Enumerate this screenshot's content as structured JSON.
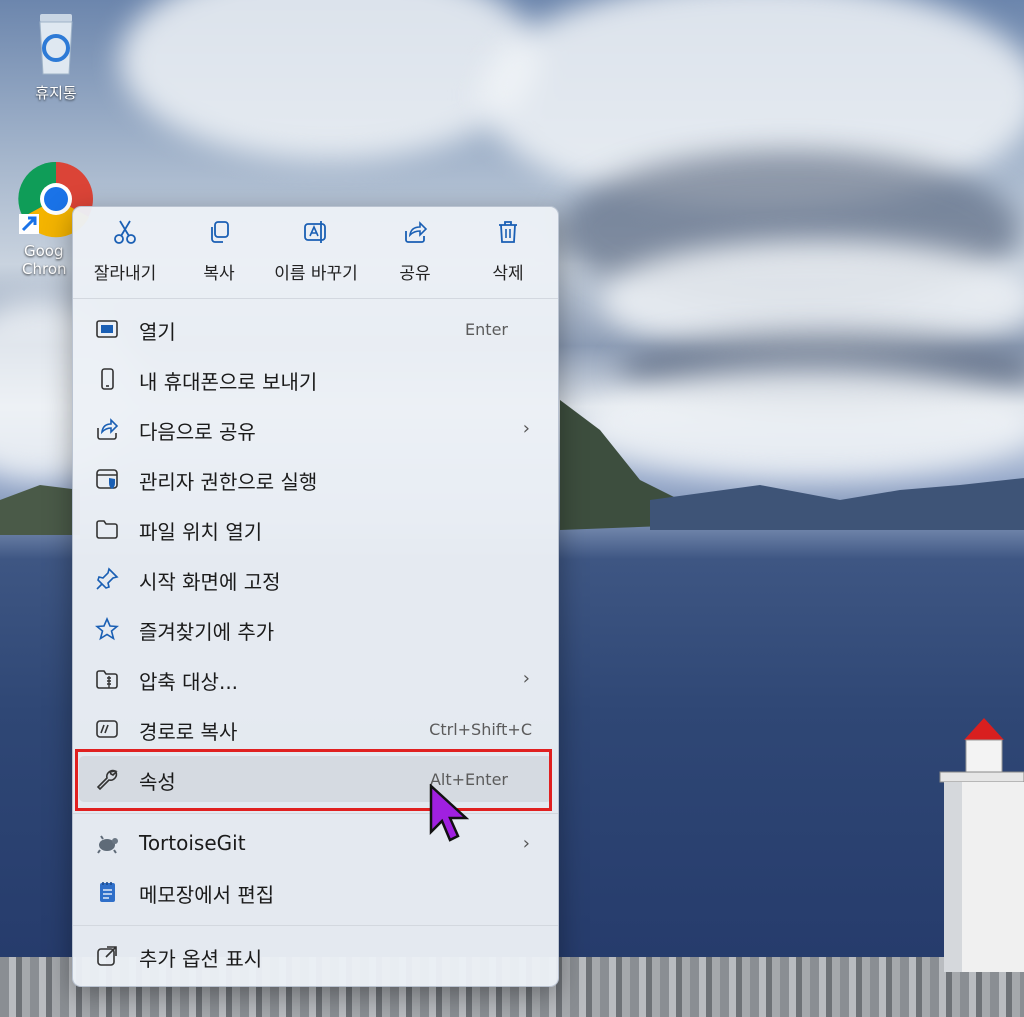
{
  "desktop": {
    "recycle_bin_label": "휴지통",
    "chrome_label_line1": "Goog",
    "chrome_label_line2": "Chron"
  },
  "toolbar": {
    "cut_label": "잘라내기",
    "copy_label": "복사",
    "rename_label": "이름 바꾸기",
    "share_label": "공유",
    "delete_label": "삭제"
  },
  "menu": {
    "open": {
      "label": "열기",
      "shortcut": "Enter"
    },
    "send_phone": {
      "label": "내 휴대폰으로 보내기"
    },
    "share_with": {
      "label": "다음으로 공유"
    },
    "run_admin": {
      "label": "관리자 권한으로 실행"
    },
    "open_location": {
      "label": "파일 위치 열기"
    },
    "pin_start": {
      "label": "시작 화면에 고정"
    },
    "add_favorites": {
      "label": "즐겨찾기에 추가"
    },
    "compress": {
      "label": "압축 대상..."
    },
    "copy_path": {
      "label": "경로로 복사",
      "shortcut": "Ctrl+Shift+C"
    },
    "properties": {
      "label": "속성",
      "shortcut": "Alt+Enter"
    },
    "tortoisegit": {
      "label": "TortoiseGit"
    },
    "notepad_edit": {
      "label": "메모장에서 편집"
    },
    "more_options": {
      "label": "추가 옵션 표시"
    }
  },
  "colors": {
    "accent_icon": "#1a5fb4",
    "highlight_box": "#e02020",
    "cursor": "#a020e0"
  }
}
